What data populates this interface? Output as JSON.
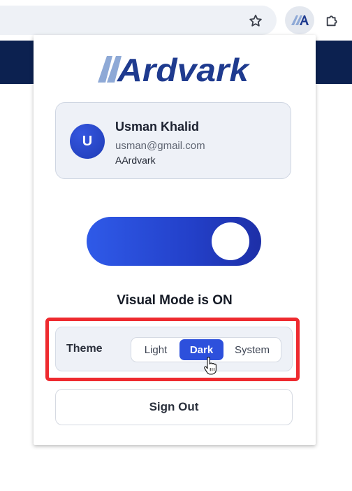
{
  "browser": {
    "bookmark_icon": "star-icon",
    "extension_icon": "ardvark-extension-icon",
    "extensions_menu_icon": "puzzle-piece-icon"
  },
  "popup": {
    "logo_text": "AArdvark",
    "user": {
      "avatar_initial": "U",
      "name": "Usman Khalid",
      "email": "usman@gmail.com",
      "organization": "AArdvark"
    },
    "visual_mode": {
      "enabled": true,
      "status_text": "Visual Mode is ON"
    },
    "theme": {
      "label": "Theme",
      "options": [
        "Light",
        "Dark",
        "System"
      ],
      "selected": "Dark"
    },
    "sign_out_label": "Sign Out"
  },
  "colors": {
    "accent": "#2d50dc",
    "page_header": "#0c2150",
    "highlight": "#ee2a2f",
    "logo_primary": "#1f3b8f",
    "logo_secondary": "#8ea9d6"
  }
}
